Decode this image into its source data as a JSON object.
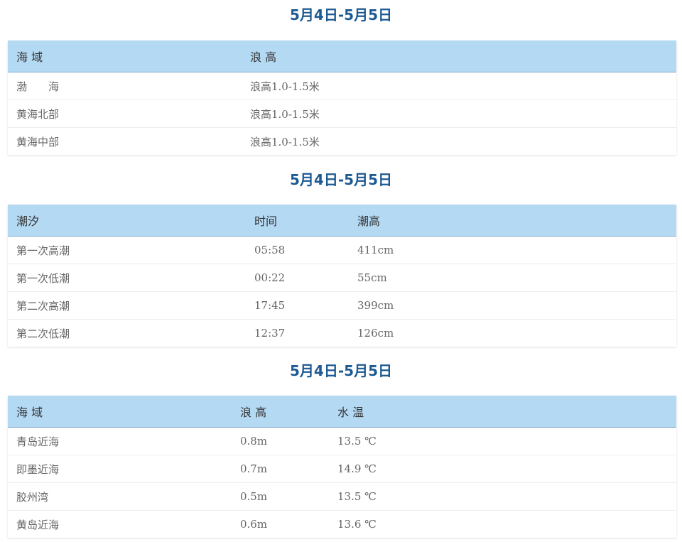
{
  "wave_section": {
    "title": "5月4日-5月5日",
    "headers": [
      "海 域",
      "浪 高"
    ],
    "rows": [
      [
        "渤　　海",
        "浪高1.0-1.5米"
      ],
      [
        "黄海北部",
        "浪高1.0-1.5米"
      ],
      [
        "黄海中部",
        "浪高1.0-1.5米"
      ]
    ]
  },
  "tide_section": {
    "title": "5月4日-5月5日",
    "headers": [
      "潮汐",
      "时间",
      "潮高"
    ],
    "rows": [
      [
        "第一次高潮",
        "05:58",
        "411cm"
      ],
      [
        "第一次低潮",
        "00:22",
        "55cm"
      ],
      [
        "第二次高潮",
        "17:45",
        "399cm"
      ],
      [
        "第二次低潮",
        "12:37",
        "126cm"
      ]
    ]
  },
  "local_section": {
    "title": "5月4日-5月5日",
    "headers": [
      "海 域",
      "浪 高",
      "水 温"
    ],
    "rows": [
      [
        "青岛近海",
        "0.8m",
        "13.5 ℃"
      ],
      [
        "即墨近海",
        "0.7m",
        "14.9 ℃"
      ],
      [
        "胶州湾",
        "0.5m",
        "13.5 ℃"
      ],
      [
        "黄岛近海",
        "0.6m",
        "13.6 ℃"
      ]
    ]
  }
}
